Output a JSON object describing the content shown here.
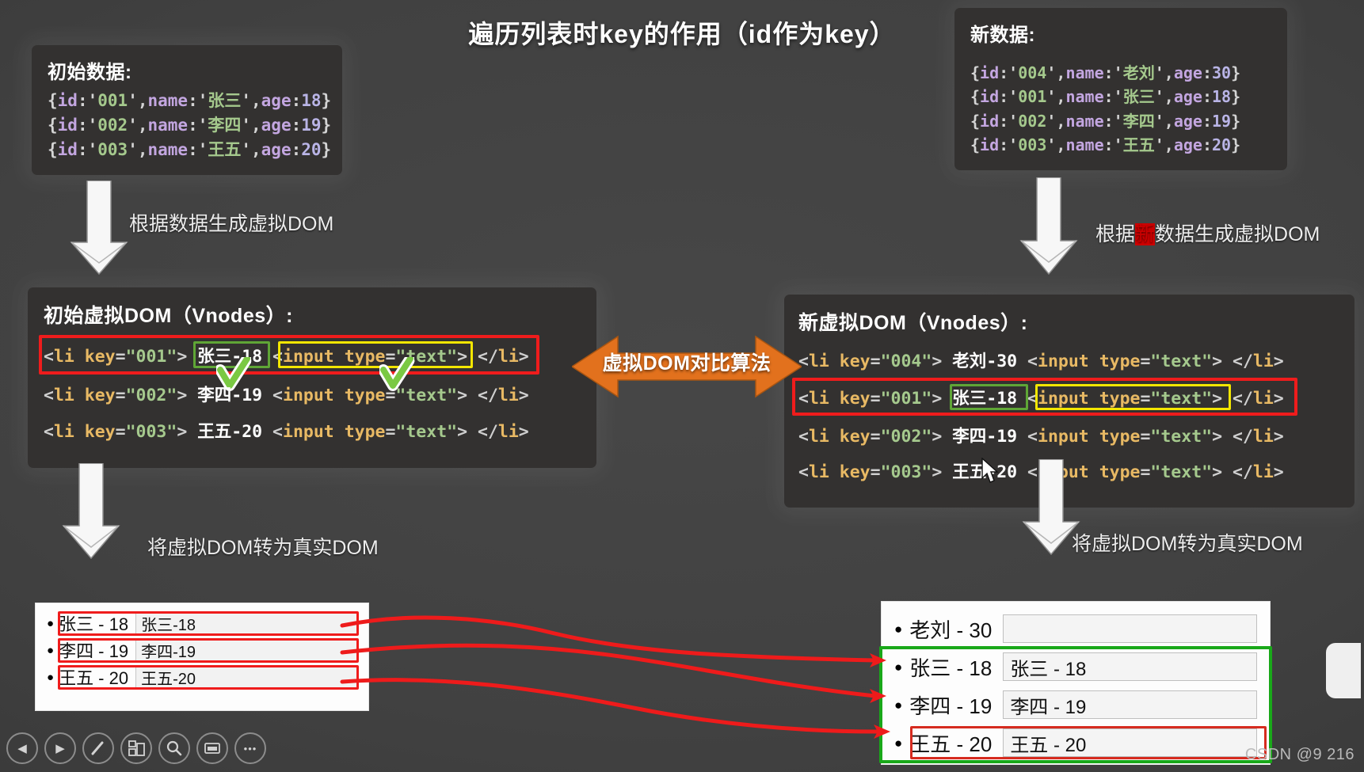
{
  "title": "遍历列表时key的作用（id作为key）",
  "initial_data": {
    "heading": "初始数据:",
    "rows": [
      {
        "id": "001",
        "name": "张三",
        "age": "18"
      },
      {
        "id": "002",
        "name": "李四",
        "age": "19"
      },
      {
        "id": "003",
        "name": "王五",
        "age": "20"
      }
    ]
  },
  "new_data": {
    "heading": "新数据:",
    "rows": [
      {
        "id": "004",
        "name": "老刘",
        "age": "30"
      },
      {
        "id": "001",
        "name": "张三",
        "age": "18"
      },
      {
        "id": "002",
        "name": "李四",
        "age": "19"
      },
      {
        "id": "003",
        "name": "王五",
        "age": "20"
      }
    ]
  },
  "old_vdom": {
    "heading": "初始虚拟DOM（Vnodes）:",
    "rows": [
      {
        "key": "001",
        "text": "张三-18",
        "input": "<input type=\"text\">",
        "close": "</li>"
      },
      {
        "key": "002",
        "text": "李四-19",
        "input": "<input type=\"text\">",
        "close": "</li>"
      },
      {
        "key": "003",
        "text": "王五-20",
        "input": "<input type=\"text\">",
        "close": "</li>"
      }
    ]
  },
  "new_vdom": {
    "heading": "新虚拟DOM（Vnodes）:",
    "rows": [
      {
        "key": "004",
        "text": "老刘-30",
        "input": "<input type=\"text\">",
        "close": "</li>"
      },
      {
        "key": "001",
        "text": "张三-18",
        "input": "<input type=\"text\">",
        "close": "</li>"
      },
      {
        "key": "002",
        "text": "李四-19",
        "input": "<input type=\"text\">",
        "close": "</li>"
      },
      {
        "key": "003",
        "text": "王五-20",
        "input": "<input type=\"text\">",
        "close": "</li>"
      }
    ]
  },
  "annotations": {
    "gen_vdom_left": "根据数据生成虚拟DOM",
    "gen_vdom_right_pre": "根据",
    "gen_vdom_right_mark": "新",
    "gen_vdom_right_post": "数据生成虚拟DOM",
    "to_real_left": "将虚拟DOM转为真实DOM",
    "to_real_right": "将虚拟DOM转为真实DOM",
    "diff_arrow": "虚拟DOM对比算法"
  },
  "real_left": {
    "rows": [
      {
        "label": "张三 - 18",
        "value": "张三-18"
      },
      {
        "label": "李四 - 19",
        "value": "李四-19"
      },
      {
        "label": "王五 - 20",
        "value": "王五-20"
      }
    ]
  },
  "real_right": {
    "rows": [
      {
        "label": "老刘 - 30",
        "value": ""
      },
      {
        "label": "张三 - 18",
        "value": "张三 - 18"
      },
      {
        "label": "李四 - 19",
        "value": "李四 - 19"
      },
      {
        "label": "王五 - 20",
        "value": "王五 - 20"
      }
    ]
  },
  "toolbar": {
    "buttons": [
      {
        "name": "prev-slide-button",
        "glyph": "◀"
      },
      {
        "name": "next-slide-button",
        "glyph": "▶"
      },
      {
        "name": "pen-tool-button",
        "glyph": "✎"
      },
      {
        "name": "slide-overview-button",
        "glyph": "▣"
      },
      {
        "name": "zoom-search-button",
        "glyph": "🔍"
      },
      {
        "name": "presenter-view-button",
        "glyph": "▤"
      },
      {
        "name": "more-options-button",
        "glyph": "•••"
      }
    ]
  },
  "watermark": "CSDN @9 216",
  "colors": {
    "highlight_red": "#ef1c1c",
    "highlight_green": "#5fa636",
    "highlight_yellow": "#f3e600",
    "arrow_orange": "#e2711d",
    "panel_bg": "#333130",
    "page_bg": "#3d3d3d",
    "mark_red": "#cc0000"
  }
}
